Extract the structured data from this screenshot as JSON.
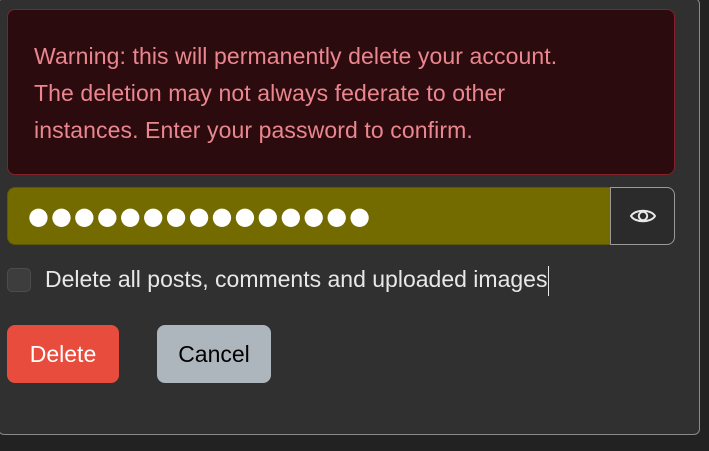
{
  "alert": {
    "lines": [
      "Warning: this will permanently delete your account.",
      "The deletion may not always federate to other",
      "instances. Enter your password to confirm."
    ]
  },
  "password": {
    "masked_value": "●●●●●●●●●●●●●●●",
    "toggle_icon": "eye-icon"
  },
  "checkbox": {
    "label": "Delete all posts, comments and uploaded images",
    "checked": false
  },
  "buttons": {
    "delete_label": "Delete",
    "cancel_label": "Cancel"
  },
  "colors": {
    "alert_bg": "#2c0b0e",
    "alert_text": "#ea868f",
    "password_bg": "#736b00",
    "delete_bg": "#e74c3c",
    "cancel_bg": "#adb5bd"
  }
}
